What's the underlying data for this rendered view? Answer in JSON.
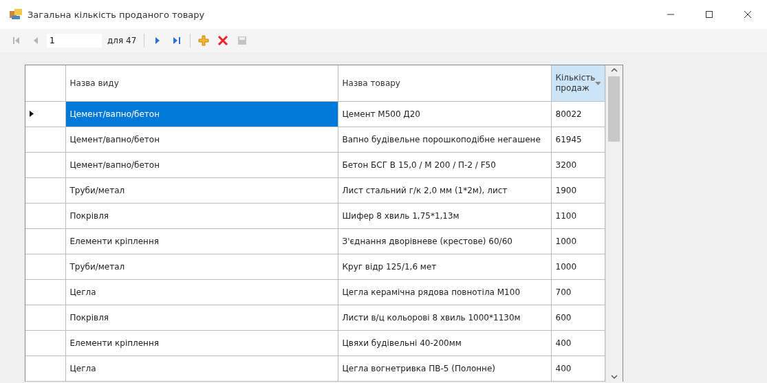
{
  "window": {
    "title": "Загальна кількість проданого товару"
  },
  "toolbar": {
    "items": [
      {
        "kind": "first",
        "disabled": true
      },
      {
        "kind": "prev",
        "disabled": true
      },
      {
        "kind": "position",
        "value": "1"
      },
      {
        "kind": "count",
        "label": "для 47"
      },
      {
        "kind": "sep"
      },
      {
        "kind": "next",
        "disabled": false
      },
      {
        "kind": "last",
        "disabled": false
      },
      {
        "kind": "sep"
      },
      {
        "kind": "add",
        "disabled": false
      },
      {
        "kind": "delete",
        "disabled": false
      },
      {
        "kind": "save",
        "disabled": true
      }
    ]
  },
  "table": {
    "columns": [
      {
        "label": "Назва виду",
        "sorted": false
      },
      {
        "label": "Назва товару",
        "sorted": false
      },
      {
        "label": "Кількість продаж",
        "sorted": true
      }
    ],
    "rows": [
      {
        "selected": true,
        "cells": [
          "Цемент/вапно/бетон",
          "Цемент М500 Д20",
          "80022"
        ]
      },
      {
        "selected": false,
        "cells": [
          "Цемент/вапно/бетон",
          "Вапно будівельне порошкоподібне негашене",
          "61945"
        ]
      },
      {
        "selected": false,
        "cells": [
          "Цемент/вапно/бетон",
          "Бетон БСГ В 15,0 / М 200 / П-2 / F50",
          "3200"
        ]
      },
      {
        "selected": false,
        "cells": [
          "Труби/метал",
          "Лист стальний г/к 2,0 мм (1*2м), лист",
          "1900"
        ]
      },
      {
        "selected": false,
        "cells": [
          "Покрівля",
          "Шифер 8 хвиль 1,75*1,13м",
          "1100"
        ]
      },
      {
        "selected": false,
        "cells": [
          "Елементи кріплення",
          "З'єднання дворівневе (крестове) 60/60",
          "1000"
        ]
      },
      {
        "selected": false,
        "cells": [
          "Труби/метал",
          "Круг відр 125/1,6 мет",
          "1000"
        ]
      },
      {
        "selected": false,
        "cells": [
          "Цегла",
          "Цегла керамічна рядова повнотіла  М100",
          "700"
        ]
      },
      {
        "selected": false,
        "cells": [
          "Покрівля",
          "Листи в/ц кольорові 8 хвиль 1000*1130м",
          "600"
        ]
      },
      {
        "selected": false,
        "cells": [
          "Елементи кріплення",
          "Цвяхи будівельні 40-200мм",
          "400"
        ]
      },
      {
        "selected": false,
        "cells": [
          "Цегла",
          "Цегла вогнетривка ПВ-5 (Полонне)",
          "400"
        ]
      }
    ]
  }
}
